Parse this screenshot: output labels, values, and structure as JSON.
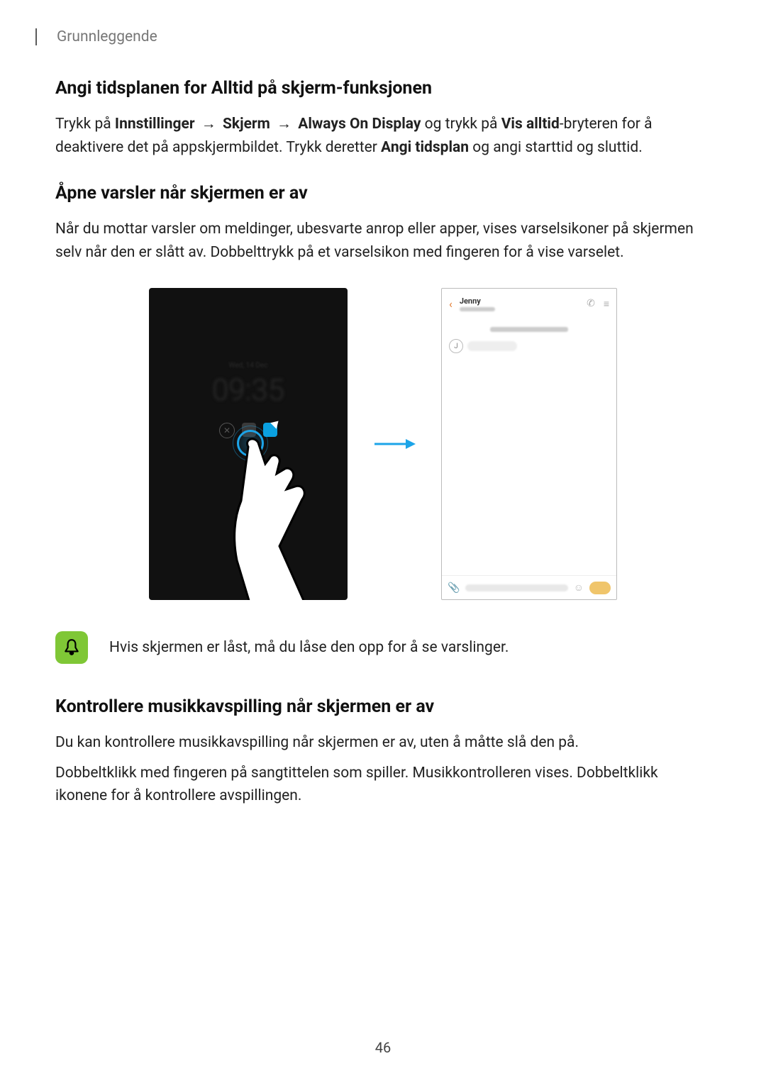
{
  "chapter": "Grunnleggende",
  "section1": {
    "heading": "Angi tidsplanen for Alltid på skjerm-funksjonen",
    "p_text_1": "Trykk på ",
    "p_bold_1": "Innstillinger",
    "p_arrow_1": " → ",
    "p_bold_2": "Skjerm",
    "p_arrow_2": " → ",
    "p_bold_3": "Always On Display",
    "p_text_2": " og trykk på ",
    "p_bold_4": "Vis alltid",
    "p_text_3": "-bryteren for å deaktivere det på appskjermbildet. Trykk deretter ",
    "p_bold_5": "Angi tidsplan",
    "p_text_4": " og angi starttid og sluttid."
  },
  "section2": {
    "heading": "Åpne varsler når skjermen er av",
    "para": "Når du mottar varsler om meldinger, ubesvarte anrop eller apper, vises varselsikoner på skjermen selv når den er slått av. Dobbelttrykk på et varselsikon med fingeren for å vise varselet."
  },
  "aod": {
    "time": "09:35",
    "day": "Wed, 14 Dec"
  },
  "messages": {
    "contact": "Jenny",
    "avatar_initial": "J"
  },
  "note": {
    "text": "Hvis skjermen er låst, må du låse den opp for å se varslinger."
  },
  "section3": {
    "heading": "Kontrollere musikkavspilling når skjermen er av",
    "p1": "Du kan kontrollere musikkavspilling når skjermen er av, uten å måtte slå den på.",
    "p2": "Dobbeltklikk med fingeren på sangtittelen som spiller. Musikkontrolleren vises. Dobbeltklikk ikonene for å kontrollere avspillingen."
  },
  "page_number": "46"
}
